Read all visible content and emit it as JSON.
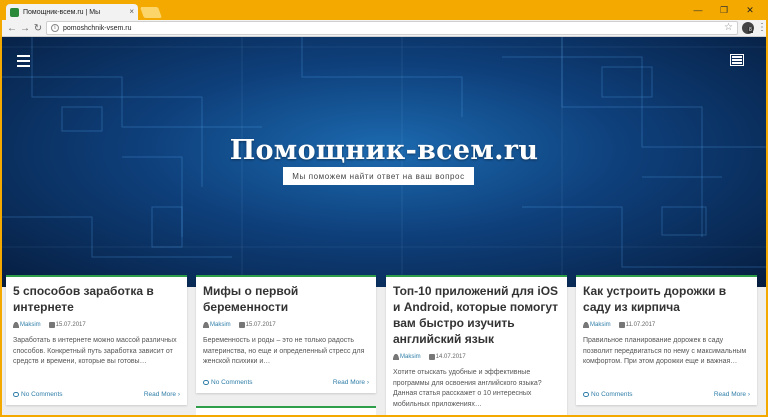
{
  "browser": {
    "tab_title": "Помощник-всем.ru | Мы",
    "tab_close": "×",
    "url": "pomoshchnik-vsem.ru",
    "icons": [
      "back-icon",
      "forward-icon",
      "reload-icon",
      "info-icon",
      "star-icon",
      "extension-icon",
      "menu-icon"
    ],
    "window_controls": [
      "—",
      "❐",
      "✕"
    ],
    "extension_badge": "8"
  },
  "site": {
    "title": "Помощник-всем.ru",
    "tagline": "Мы поможем найти ответ на ваш вопрос"
  },
  "posts": [
    {
      "title": "5 способов заработка в интернете",
      "author": "Maksim",
      "date": "15.07.2017",
      "excerpt": "Заработать в интернете можно массой различных способов. Конкретный путь заработка зависит от средств и времени, которые вы готовы…",
      "comments": "No Comments",
      "read_more": "Read More"
    },
    {
      "title": "Мифы о первой беременности",
      "author": "Maksim",
      "date": "15.07.2017",
      "excerpt": "Беременность и роды – это не только радость материнства, но еще и определенный стресс для женской психики и…",
      "comments": "No Comments",
      "read_more": "Read More"
    },
    {
      "title": "Топ-10 приложений для iOS и Android, которые помогут вам быстро изучить английский язык",
      "author": "Maksim",
      "date": "14.07.2017",
      "excerpt": "Хотите отыскать удобные и эффективные программы для освоения английского языка? Данная статья расскажет о 10 интересных мобильных приложениях…",
      "comments": "",
      "read_more": ""
    },
    {
      "title": "Как устроить дорожки в саду из кирпича",
      "author": "Maksim",
      "date": "11.07.2017",
      "excerpt": "Правильное планирование дорожек в саду позволит передвигаться по нему с максимальным комфортом. При этом дорожки еще и важная…",
      "comments": "No Comments",
      "read_more": "Read More"
    }
  ],
  "colors": {
    "accent": "#2f9e4a",
    "link": "#2f7ea8",
    "frame": "#f3a900"
  }
}
